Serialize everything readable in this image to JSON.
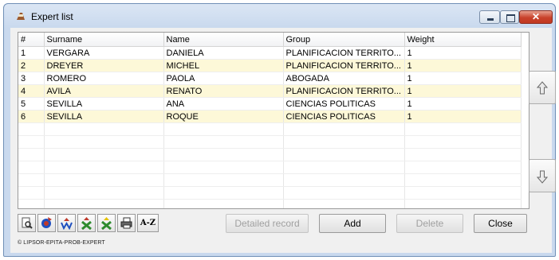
{
  "window": {
    "title": "Expert list"
  },
  "window_buttons": {
    "close_glyph": "✕"
  },
  "grid": {
    "columns": [
      "#",
      "Surname",
      "Name",
      "Group",
      "Weight"
    ],
    "rows": [
      [
        "1",
        "VERGARA",
        "DANIELA",
        "PLANIFICACION TERRITO...",
        "1"
      ],
      [
        "2",
        "DREYER",
        "MICHEL",
        "PLANIFICACION TERRITO...",
        "1"
      ],
      [
        "3",
        "ROMERO",
        "PAOLA",
        "ABOGADA",
        "1"
      ],
      [
        "4",
        "AVILA",
        "RENATO",
        "PLANIFICACION TERRITO...",
        "1"
      ],
      [
        "5",
        "SEVILLA",
        "ANA",
        "CIENCIAS POLITICAS",
        "1"
      ],
      [
        "6",
        "SEVILLA",
        "ROQUE",
        "CIENCIAS POLITICAS",
        "1"
      ]
    ],
    "alt_row_color": "#fdf8d8"
  },
  "toolbar": {
    "icons": [
      "search-icon",
      "group-icon",
      "women-icon",
      "remove-expert-icon",
      "add-expert-icon",
      "print-icon"
    ],
    "sort_label": "A-Z"
  },
  "buttons": {
    "detailed_record": "Detailed record",
    "add": "Add",
    "delete": "Delete",
    "close": "Close"
  },
  "side": {
    "up_icon": "arrow-up-icon",
    "down_icon": "arrow-down-icon"
  },
  "footer": {
    "copyright": "© LIPSOR-EPITA-PROB-EXPERT"
  },
  "colors": {
    "accent_red": "#c0392b",
    "accent_green": "#2e8b2e",
    "accent_blue": "#1f4fbf"
  }
}
